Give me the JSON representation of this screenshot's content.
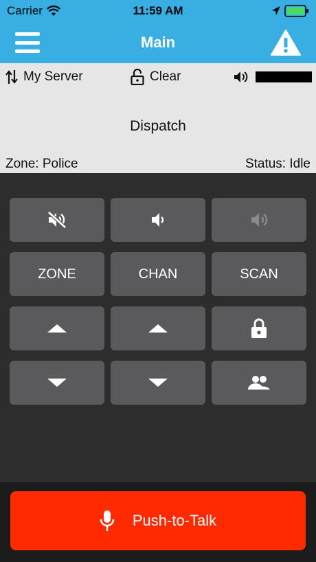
{
  "status_bar": {
    "carrier": "Carrier",
    "time": "11:59 AM"
  },
  "navbar": {
    "title": "Main",
    "menu_icon": "hamburger-icon",
    "alert_icon": "warning-icon"
  },
  "info": {
    "server": "My Server",
    "encryption": "Clear",
    "volume_level": 1.0,
    "channel": "Dispatch",
    "zone": "Zone: Police",
    "status": "Status: Idle"
  },
  "controls": {
    "zone_label": "ZONE",
    "chan_label": "CHAN",
    "scan_label": "SCAN"
  },
  "ptt": {
    "label": "Push-to-Talk"
  },
  "colors": {
    "accent": "#38aee3",
    "ptt": "#ff2a00",
    "button": "#5a5a5c",
    "background": "#2d2d2e"
  }
}
